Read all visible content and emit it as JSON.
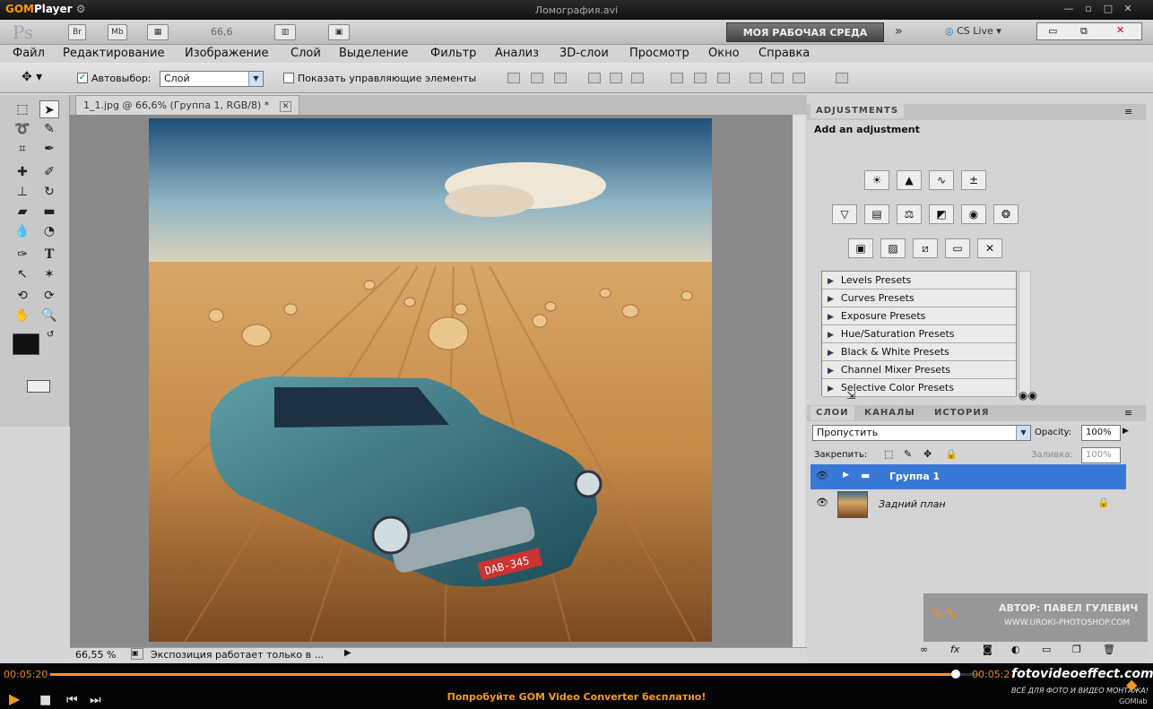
{
  "player": {
    "brand_a": "GOM",
    "brand_b": "Player",
    "filename": "Ломография.avi",
    "time_current": "00:05:20",
    "time_total": "00:05:2",
    "promo": "Попробуйте GOM Video Converter бесплатно!",
    "footer_brand": "GOMlab",
    "progress": 0.975
  },
  "ps": {
    "logo": "Ps",
    "br": "Br",
    "mb": "Mb",
    "zoom": "66,6",
    "workspace": "МОЯ РАБОЧАЯ СРЕДА",
    "cslive": "CS Live"
  },
  "menu": [
    "Файл",
    "Редактирование",
    "Изображение",
    "Слой",
    "Выделение",
    "Фильтр",
    "Анализ",
    "3D-слои",
    "Просмотр",
    "Окно",
    "Справка"
  ],
  "options": {
    "autoselect_label": "Автовыбор:",
    "autoselect_value": "Слой",
    "show_controls": "Показать управляющие элементы"
  },
  "document": {
    "tab_label": "1_1.jpg @ 66,6% (Группа 1, RGB/8) *",
    "zoom_status": "66,55 %",
    "status_text": "Экспозиция работает только в ...",
    "plate": "DAB-345"
  },
  "adjustments": {
    "tab": "ADJUSTMENTS",
    "heading": "Add an adjustment",
    "presets": [
      "Levels Presets",
      "Curves Presets",
      "Exposure Presets",
      "Hue/Saturation Presets",
      "Black & White Presets",
      "Channel Mixer Presets",
      "Selective Color Presets"
    ]
  },
  "layers": {
    "tabs": [
      "СЛОИ",
      "КАНАЛЫ",
      "ИСТОРИЯ"
    ],
    "blend_mode": "Пропустить",
    "opacity_label": "Opacity:",
    "opacity_value": "100%",
    "lock_label": "Закрепить:",
    "fill_label": "Заливка:",
    "fill_value": "100%",
    "items": [
      {
        "name": "Группа 1"
      },
      {
        "name": "Задний план"
      }
    ]
  },
  "watermark": {
    "author": "АВТОР: ПАВЕЛ ГУЛЕВИЧ",
    "site": "WWW.URОКI-PHOTOSHOP.COM",
    "fve": "fotovideoeffect.com",
    "fve_sub": "ВСЁ ДЛЯ ФОТО И ВИДЕО МОНТАЖА!"
  },
  "colors": {
    "accent": "#3a78d8",
    "gom_orange": "#f59a1e"
  }
}
